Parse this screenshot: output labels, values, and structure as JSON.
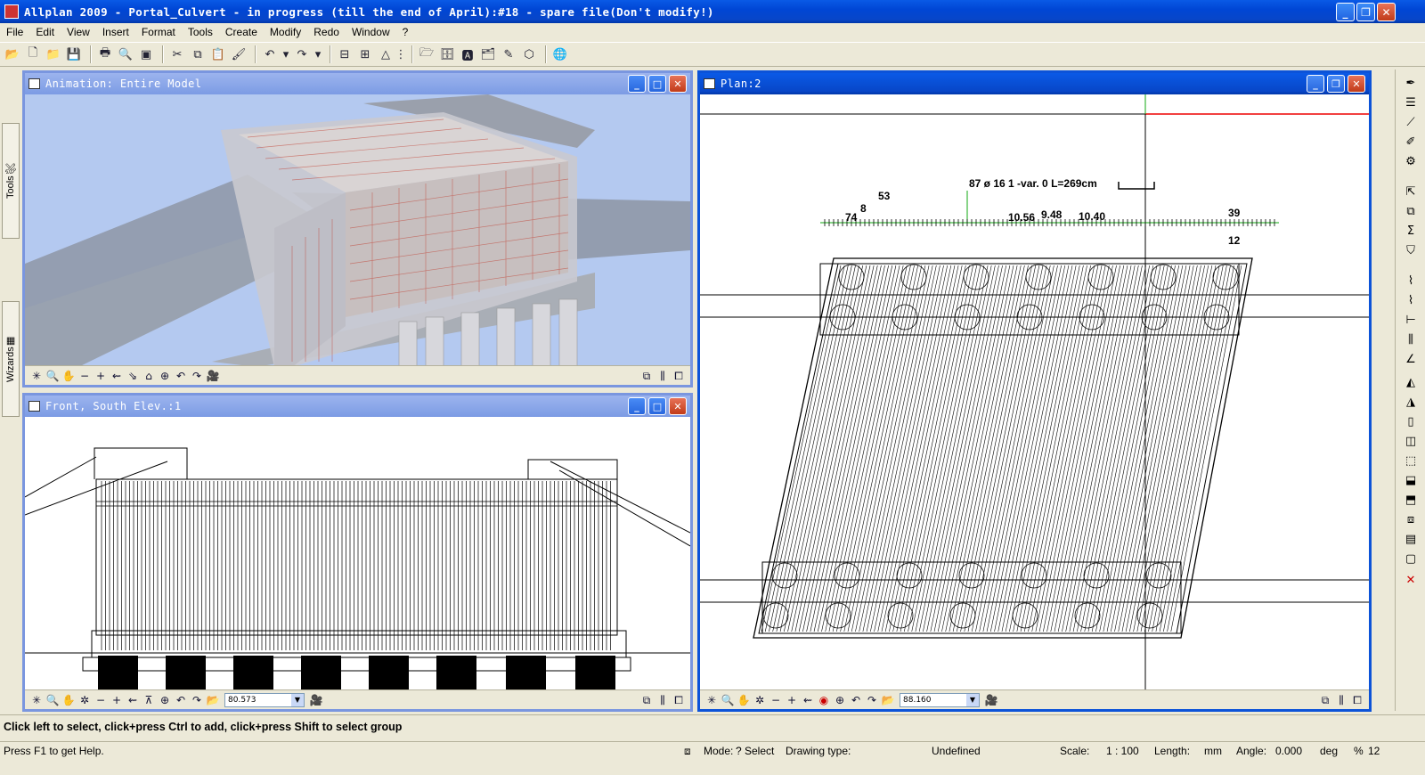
{
  "app": {
    "title": "Allplan 2009 - Portal_Culvert - in progress (till the end of April):#18 - spare file(Don't modify!)",
    "window_buttons": {
      "minimize": "_",
      "restore": "❐",
      "close": "✕"
    }
  },
  "menu": {
    "items": [
      "File",
      "Edit",
      "View",
      "Insert",
      "Format",
      "Tools",
      "Create",
      "Modify",
      "Redo",
      "Window",
      "?"
    ]
  },
  "toolbar": {
    "icons": [
      "open-project-icon",
      "new-icon",
      "open-icon",
      "save-icon",
      "print-icon",
      "print-preview-icon",
      "layout-icon",
      "cut-icon",
      "copy-icon",
      "paste-icon",
      "format-painter-icon",
      "undo-icon",
      "undo-dropdown-icon",
      "redo-icon",
      "redo-dropdown-icon",
      "dimension-icon",
      "dimension2-icon",
      "dimension3-icon",
      "more-icon",
      "explorer-icon",
      "fileset-icon",
      "text-icon",
      "layer-icon",
      "pen-icon",
      "3d-box-icon",
      "zoom-globe-icon"
    ]
  },
  "side_tabs": {
    "tools": "Tools",
    "wizards": "Wizards"
  },
  "windows": {
    "animation": {
      "title": "Animation: Entire Model"
    },
    "front": {
      "title": "Front, South Elev.:1",
      "zoom_value": "80.573"
    },
    "plan": {
      "title": "Plan:2",
      "zoom_value": "88.160",
      "labels": {
        "bar_spec": "87 ø 16 1 -var. 0  L=269cm",
        "n53": "53",
        "n8": "8",
        "n74": "74",
        "n1056": "10.56",
        "n948": "9.48",
        "n1040": "10.40",
        "n39": "39",
        "n12": "12"
      }
    }
  },
  "prompt": {
    "text": "Click left to select, click+press Ctrl to add, click+press Shift to select group"
  },
  "status": {
    "help": "Press F1 to get Help.",
    "mode_label": "Mode:",
    "mode_value": "? Select",
    "drawing_type_label": "Drawing type:",
    "drawing_type_value": "Undefined",
    "scale_label": "Scale:",
    "scale_value": "1 : 100",
    "length_label": "Length:",
    "length_value": "mm",
    "angle_label": "Angle:",
    "angle_value": "0.000",
    "angle_unit": "deg",
    "percent_label": "%",
    "percent_value": "12"
  },
  "colors": {
    "xp_blue": "#0C53D8",
    "xp_face": "#ECE9D8",
    "sky": "#B4C9F0",
    "rebar_red": "#C0392B"
  }
}
